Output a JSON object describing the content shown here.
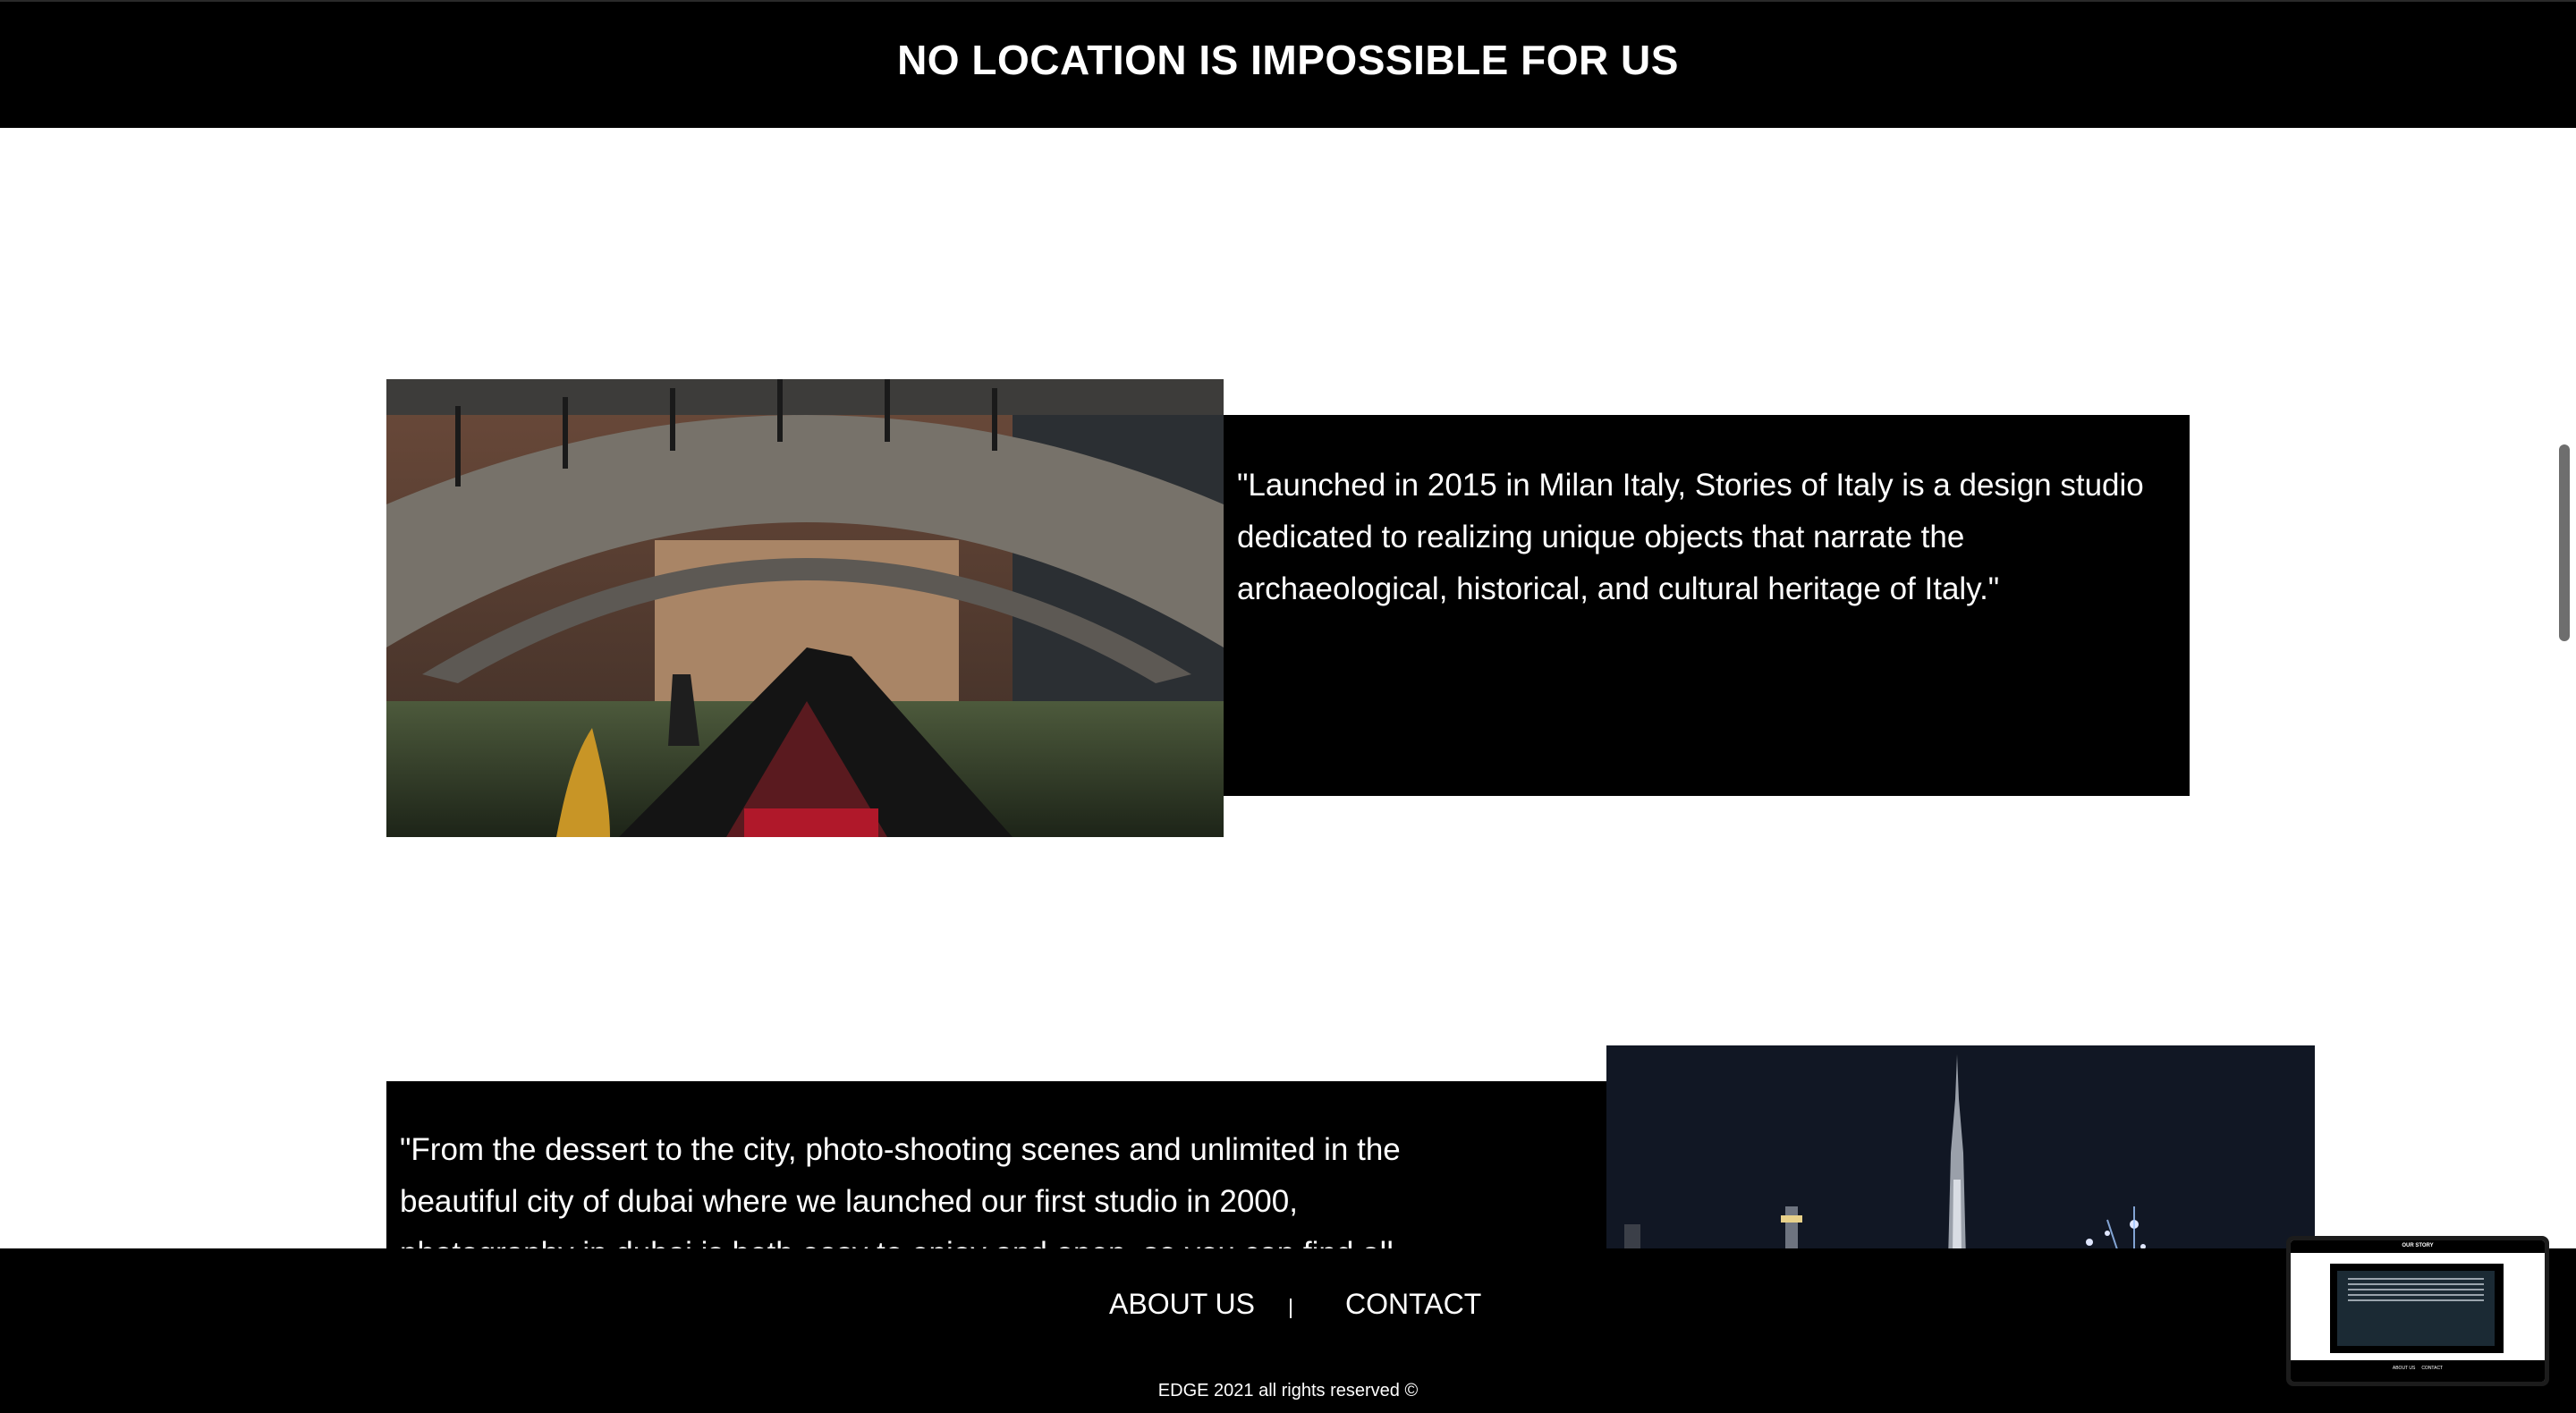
{
  "header": {
    "title": "NO LOCATION IS IMPOSSIBLE FOR US"
  },
  "section1": {
    "quote": "\"Launched in 2015 in Milan Italy, Stories of Italy is a design studio dedicated to realizing unique objects that narrate the archaeological, historical, and cultural heritage of Italy.\""
  },
  "section2": {
    "quote": "\"From the dessert to the city, photo-shooting scenes and unlimited in the beautiful city of dubai where we launched our first studio in 2000, photography in dubai is both easy to enjoy and open, so you can find all kinds of"
  },
  "footer": {
    "about_label": "ABOUT US",
    "separator": "|",
    "contact_label": "CONTACT",
    "copyright": "EDGE 2021 all rights reserved ©"
  },
  "preview": {
    "title": "OUR STORY",
    "about_label": "ABOUT US",
    "contact_label": "CONTACT"
  },
  "colors": {
    "bar_background": "#000000",
    "page_background": "#ffffff",
    "text_light": "#ffffff"
  },
  "icons": {
    "scrollbar": "scrollbar-thumb"
  }
}
